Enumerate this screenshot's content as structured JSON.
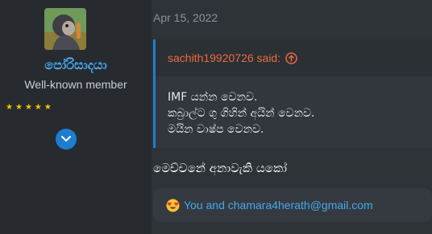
{
  "author": {
    "username": "පෝරිසාදයා",
    "title": "Well-known member",
    "rating_stars": 5,
    "star_glyph": "★"
  },
  "post": {
    "date": "Apr 15, 2022",
    "quote": {
      "author_said": "sachith19920726 said:",
      "lines": [
        "IMF යන්න වෙනව.",
        "කබ්‍රාල්ට ගු ගිහින් අයින් වෙනව.",
        "මයින වාෂ්ප වෙනව."
      ]
    },
    "message": "මෙච්චනේ අනාවැකි යකෝ",
    "reactions": {
      "emoji": "heart-eyes",
      "text": "You and chamara4herath@gmail.com"
    }
  },
  "colors": {
    "accent_blue": "#47a7eb",
    "quote_author": "#ec6a3a",
    "star": "#f6c400"
  }
}
